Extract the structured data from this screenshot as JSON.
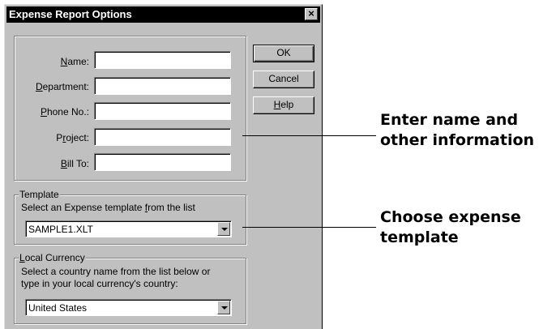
{
  "window": {
    "title": "Expense Report Options",
    "close_glyph": "×"
  },
  "fields": [
    {
      "label_pre": "",
      "label_ul": "N",
      "label_post": "ame:",
      "value": ""
    },
    {
      "label_pre": "",
      "label_ul": "D",
      "label_post": "epartment:",
      "value": ""
    },
    {
      "label_pre": "",
      "label_ul": "P",
      "label_post": "hone No.:",
      "value": ""
    },
    {
      "label_pre": "P",
      "label_ul": "r",
      "label_post": "oject:",
      "value": ""
    },
    {
      "label_pre": "",
      "label_ul": "B",
      "label_post": "ill To:",
      "value": ""
    }
  ],
  "buttons": {
    "ok": "OK",
    "cancel": "Cancel",
    "help_ul": "H",
    "help_post": "elp"
  },
  "template": {
    "legend": "Template",
    "desc_pre": "Select an Expense template ",
    "desc_ul": "f",
    "desc_post": "rom the list",
    "selected": "SAMPLE1.XLT"
  },
  "currency": {
    "legend_ul": "L",
    "legend_post": "ocal Currency",
    "desc_line1": "Select a country name from the list below or",
    "desc_line2": "type in your local currency's country:",
    "selected": "United States"
  },
  "callouts": {
    "info_line1": "Enter name and",
    "info_line2": "other information",
    "template_line1": "Choose expense",
    "template_line2": "template"
  }
}
